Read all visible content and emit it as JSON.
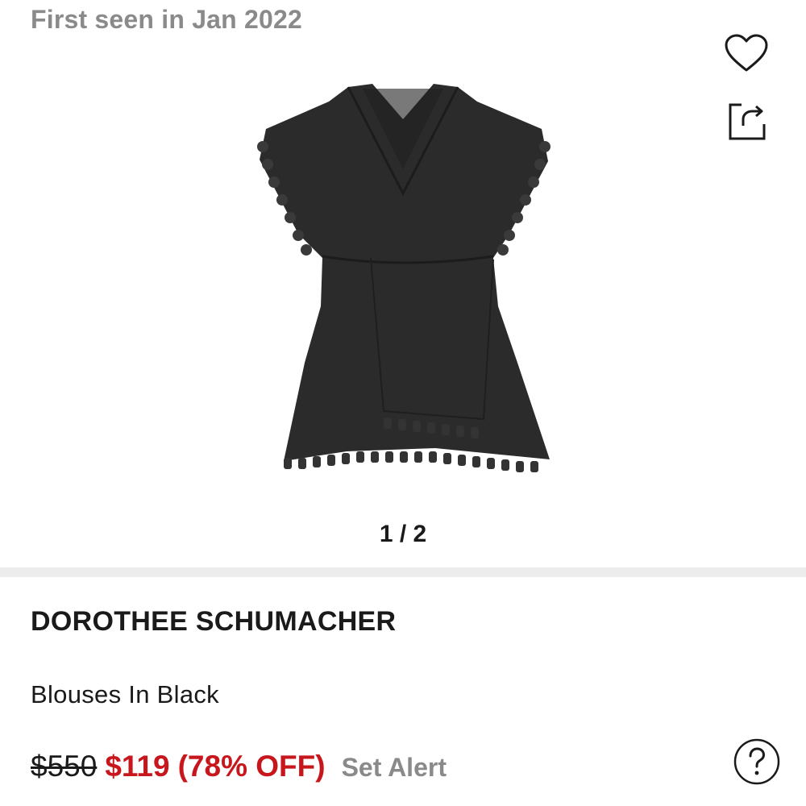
{
  "header": {
    "first_seen": "First seen in Jan 2022"
  },
  "actions": {
    "favorite_icon": "heart-icon",
    "share_icon": "share-icon",
    "help_icon": "question-icon"
  },
  "gallery": {
    "counter": "1 / 2",
    "current": 1,
    "total": 2
  },
  "product": {
    "brand": "DOROTHEE SCHUMACHER",
    "name": "Blouses In Black",
    "original_price": "$550",
    "sale_price": "$119",
    "discount": "(78% OFF)",
    "set_alert_label": "Set Alert"
  },
  "colors": {
    "sale_red": "#c8161d",
    "muted_gray": "#8a8a8a",
    "divider": "#ececec"
  }
}
